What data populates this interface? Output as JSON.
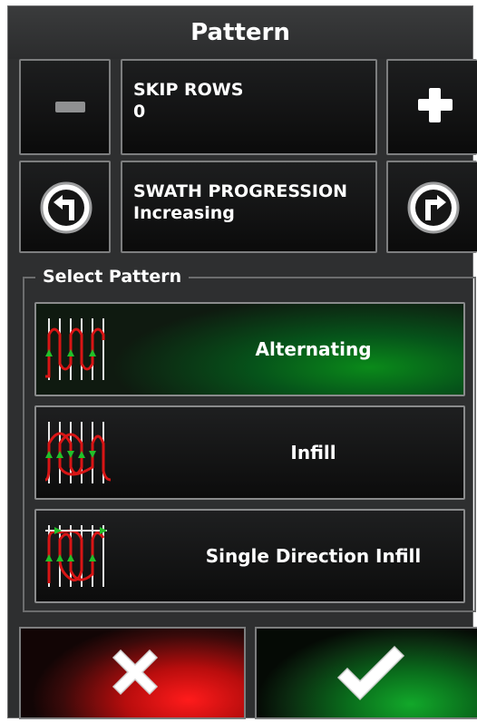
{
  "title": "Pattern",
  "skip_rows": {
    "label": "SKIP ROWS",
    "value": "0"
  },
  "swath_progression": {
    "label": "SWATH PROGRESSION",
    "value": "Increasing"
  },
  "select_pattern": {
    "heading": "Select Pattern",
    "options": [
      {
        "label": "Alternating",
        "icon": "alternating-pattern-icon",
        "selected": true
      },
      {
        "label": "Infill",
        "icon": "infill-pattern-icon",
        "selected": false
      },
      {
        "label": "Single Direction Infill",
        "icon": "single-direction-infill-pattern-icon",
        "selected": false
      }
    ]
  },
  "colors": {
    "selected": "#0a8a1a",
    "cancel": "#e01010",
    "confirm": "#0a9a22",
    "path": "#d81515",
    "arrow": "#22c02a"
  }
}
